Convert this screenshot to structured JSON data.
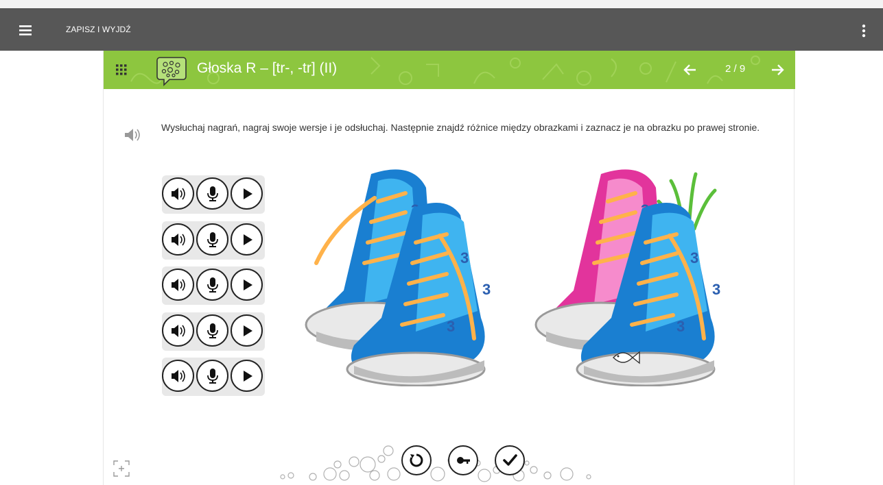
{
  "appbar": {
    "save_exit_label": "ZAPISZ I WYJDŹ"
  },
  "lesson": {
    "title": "Głoska R – [tr-, -tr] (II)",
    "pager": "2 / 9",
    "accent_color": "#8dc63f"
  },
  "exercise": {
    "instruction": "Wysłuchaj nagrań, nagraj swoje wersje i je odsłuchaj. Następnie znajdź różnice między obrazkami i zaznacz je na obrazku po prawej stronie.",
    "audio_rows": [
      {
        "buttons": [
          "listen-icon",
          "microphone-icon",
          "play-icon"
        ]
      },
      {
        "buttons": [
          "listen-icon",
          "microphone-icon",
          "play-icon"
        ]
      },
      {
        "buttons": [
          "listen-icon",
          "microphone-icon",
          "play-icon"
        ]
      },
      {
        "buttons": [
          "listen-icon",
          "microphone-icon",
          "play-icon"
        ]
      },
      {
        "buttons": [
          "listen-icon",
          "microphone-icon",
          "play-icon"
        ]
      }
    ],
    "left_picture": "blue-sneakers",
    "right_picture": "sneakers-with-differences"
  },
  "toolbar": {
    "buttons": [
      "reset-icon",
      "key-icon",
      "check-icon"
    ]
  }
}
